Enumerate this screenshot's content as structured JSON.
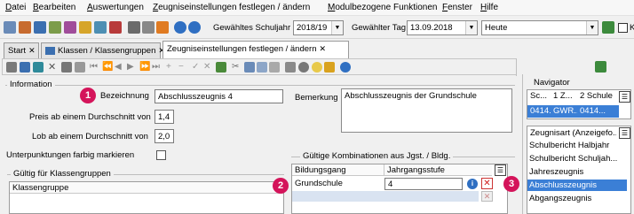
{
  "menu": [
    "Datei",
    "Bearbeiten",
    "Auswertungen",
    "Zeugniseinstellungen festlegen / ändern",
    "Modulbezogene Funktionen",
    "Fenster",
    "Hilfe"
  ],
  "toolbar": {
    "school_year_label": "Gewähltes Schuljahr",
    "school_year_value": "2018/19",
    "day_label": "Gewählter Tag",
    "day_value": "13.09.2018",
    "today_value": "Heute",
    "k_label": "K"
  },
  "tabs": [
    {
      "label": "Start",
      "active": false
    },
    {
      "label": "Klassen / Klassengruppen",
      "active": false
    },
    {
      "label": "Zeugniseinstellungen festlegen / ändern",
      "active": true
    }
  ],
  "info": {
    "section_title": "Information",
    "bezeichnung_label": "Bezeichnung",
    "bezeichnung_value": "Abschlusszeugnis 4",
    "preis_label": "Preis ab einem Durchschnitt von",
    "preis_value": "1,4",
    "lob_label": "Lob ab einem Durchschnitt von",
    "lob_value": "2,0",
    "unterpunkt_label": "Unterpunktungen farbig markieren",
    "unterpunkt_checked": false,
    "bemerkung_label": "Bemerkung",
    "bemerkung_value": "Abschlusszeugnis der Grundschule"
  },
  "gueltig_klassen": {
    "title": "Gültig für Klassengruppen",
    "column_header": "Klassengruppe"
  },
  "gueltig_kombi": {
    "title": "Gültige Kombinationen aus Jgst. / Bldg.",
    "headers": [
      "Bildungsgang",
      "Jahrgangsstufe"
    ],
    "rows": [
      {
        "bildungsgang": "Grundschule",
        "jahrgangsstufe": "4"
      }
    ]
  },
  "badges": [
    "1",
    "2",
    "3"
  ],
  "navigator": {
    "title": "Navigator",
    "top_headers": [
      "Sc...",
      "1 Z...",
      "2 Schule"
    ],
    "top_row": [
      "0414...",
      "GWR...",
      "0414..."
    ],
    "list_header": "Zeugnisart (Anzeigefo...",
    "items": [
      "Schulbericht Halbjahr",
      "Schulbericht Schuljah...",
      "Jahreszeugnis",
      "Abschlusszeugnis",
      "Abgangszeugnis"
    ],
    "selected_index": 3
  },
  "colors": {
    "badge": "#d4145a",
    "selection": "#3b7fd6"
  }
}
